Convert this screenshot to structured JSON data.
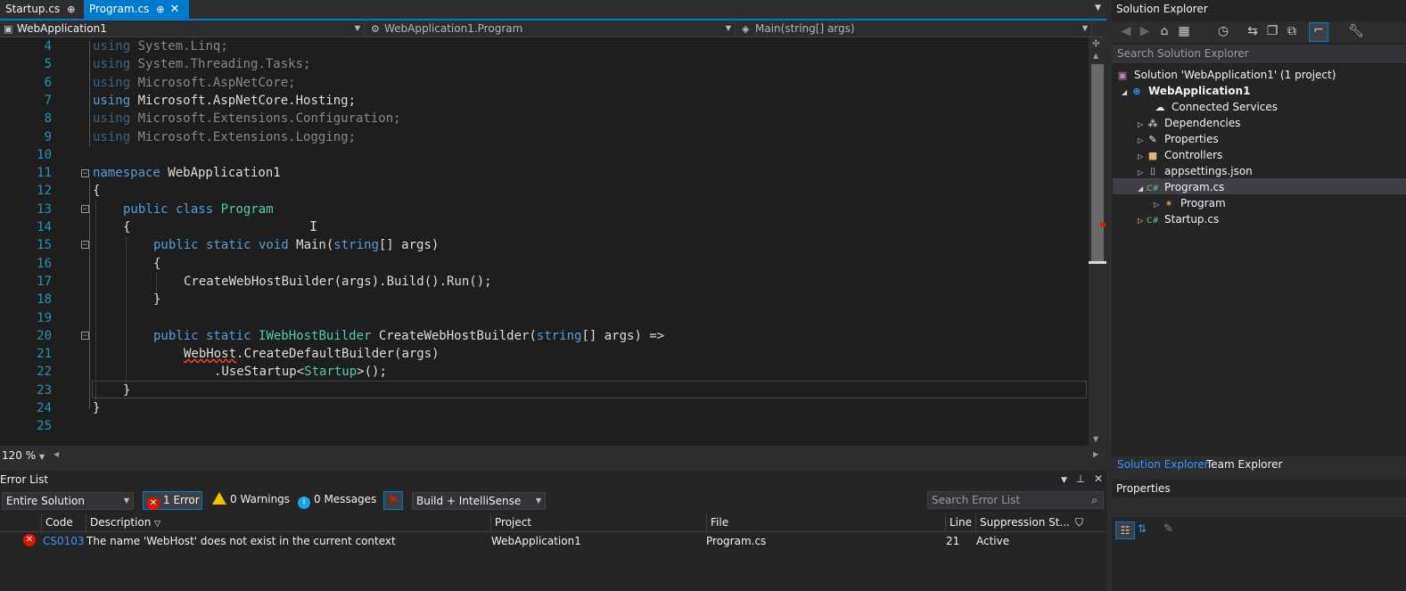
{
  "tabs": {
    "startup": "Startup.cs",
    "program": "Program.cs",
    "pin_glyph": "⊕",
    "close_glyph": "✕"
  },
  "navbar": {
    "project": "WebApplication1",
    "class": "WebApplication1.Program",
    "member": "Main(string[] args)"
  },
  "editor": {
    "zoom": "120 %",
    "line_numbers": [
      "4",
      "5",
      "6",
      "7",
      "8",
      "9",
      "10",
      "11",
      "12",
      "13",
      "14",
      "15",
      "16",
      "17",
      "18",
      "19",
      "20",
      "21",
      "22",
      "23",
      "24",
      "25"
    ],
    "lines": {
      "l4_kw": "using",
      "l4_rest": " System.Linq;",
      "l5_kw": "using",
      "l5_rest": " System.Threading.Tasks;",
      "l6_kw": "using",
      "l6_rest": " Microsoft.AspNetCore;",
      "l7_kw": "using",
      "l7_rest": " Microsoft.AspNetCore.Hosting;",
      "l8_kw": "using",
      "l8_rest": " Microsoft.Extensions.Configuration;",
      "l9_kw": "using",
      "l9_rest": " Microsoft.Extensions.Logging;",
      "l11_kw": "namespace",
      "l11_rest": " WebApplication1",
      "l12": "{",
      "l13_kw": "public class",
      "l13_ty": "Program",
      "l14": "{",
      "l15_kw": "public static void",
      "l15_name": " Main(",
      "l15_kw2": "string",
      "l15_rest": "[] args)",
      "l16": "{",
      "l17": "CreateWebHostBuilder(args).Build().Run();",
      "l18": "}",
      "l20_kw": "public static",
      "l20_ty": "IWebHostBuilder",
      "l20_name": " CreateWebHostBuilder(",
      "l20_kw2": "string",
      "l20_rest": "[] args) =>",
      "l21_err": "WebHost",
      "l21_rest": ".CreateDefaultBuilder(args)",
      "l22_a": ".UseStartup<",
      "l22_ty": "Startup",
      "l22_b": ">();",
      "l23": "}",
      "l24": "}"
    }
  },
  "error_list": {
    "title": "Error List",
    "scope": "Entire Solution",
    "errors_label": "1 Error",
    "warnings_label": "0 Warnings",
    "messages_label": "0 Messages",
    "source": "Build + IntelliSense",
    "search_placeholder": "Search Error List",
    "columns": {
      "code": "Code",
      "description": "Description",
      "project": "Project",
      "file": "File",
      "line": "Line",
      "suppression": "Suppression St..."
    },
    "rows": [
      {
        "code": "CS0103",
        "description": "The name 'WebHost' does not exist in the current context",
        "project": "WebApplication1",
        "file": "Program.cs",
        "line": "21",
        "suppression": "Active"
      }
    ]
  },
  "solution_explorer": {
    "title": "Solution Explorer",
    "search_placeholder": "Search Solution Explorer",
    "nodes": {
      "solution": "Solution 'WebApplication1' (1 project)",
      "project": "WebApplication1",
      "connected": "Connected Services",
      "dependencies": "Dependencies",
      "properties": "Properties",
      "controllers": "Controllers",
      "appsettings": "appsettings.json",
      "program_cs": "Program.cs",
      "program_class": "Program",
      "startup_cs": "Startup.cs"
    },
    "tabs": {
      "solution_explorer": "Solution Explorer",
      "team_explorer": "Team Explorer"
    }
  },
  "properties": {
    "title": "Properties"
  },
  "colors": {
    "accent": "#007acc",
    "editor_bg": "#1e1e1e",
    "keyword": "#569cd6",
    "type": "#4ec9b0",
    "line_number": "#2b91af",
    "error": "#e51400"
  }
}
